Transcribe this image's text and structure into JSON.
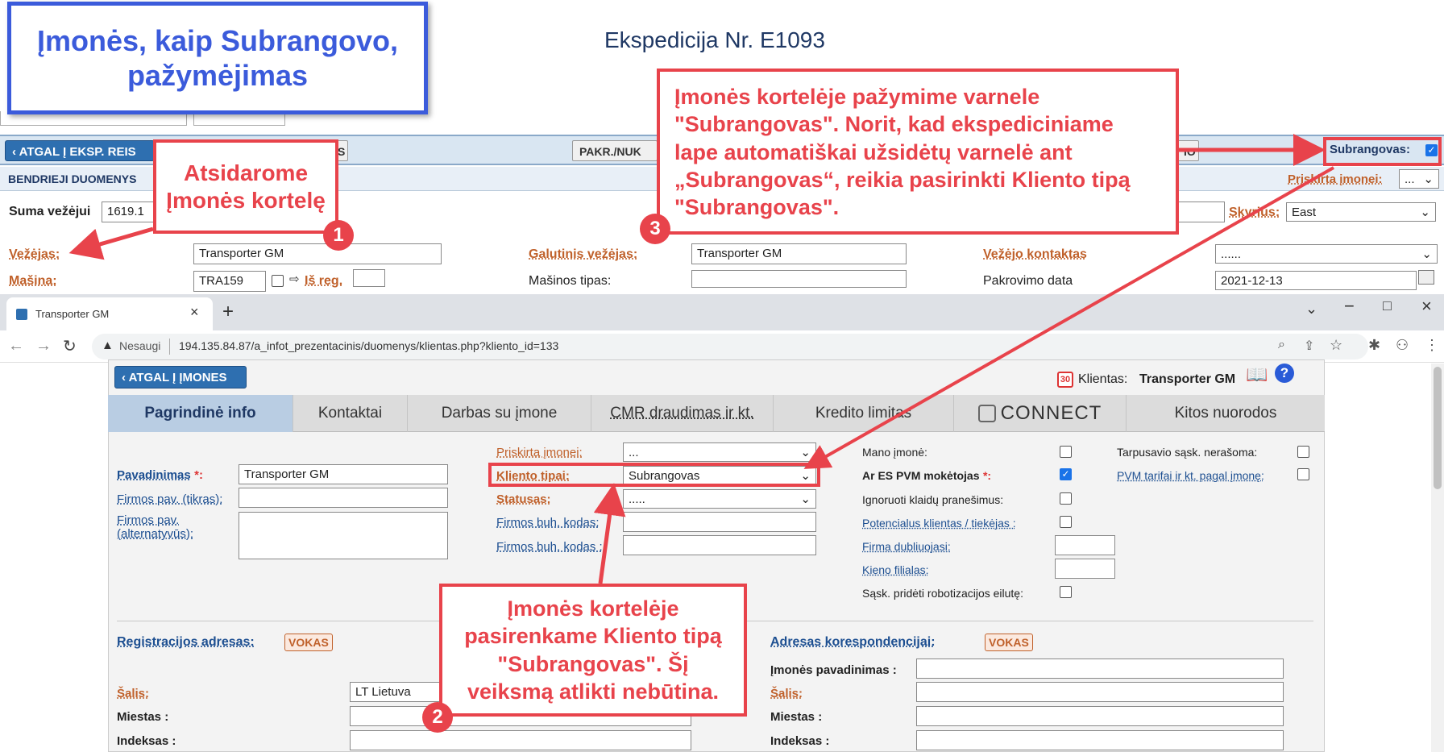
{
  "annotation_title": "Įmonės, kaip Subrangovo, pažymėjimas",
  "bg_app": {
    "expedition_title": "Ekspedicija Nr. E1093",
    "back_button": "ATGAL Į EKSP. REIS",
    "pakr_button": "PAKR./NUK",
    "partial_button": "S",
    "partial_button2": "IO",
    "subrangovas_label": "Subrangovas:",
    "section_label": "BENDRIEJI DUOMENYS",
    "priskirta_label": "Priskirta įmonei:",
    "priskirta_value": "...",
    "suma_label": "Suma vežėjui",
    "suma_value": "1619.1",
    "skyrius_label": "Skyrius:",
    "skyrius_value": "East",
    "vezejas_label": "Vežėjas:",
    "vezejas_value": "Transporter GM",
    "galutinis_label": "Galutinis vežėjas:",
    "galutinis_value": "Transporter GM",
    "vezejo_kontaktas_label": "Vežėjo kontaktas",
    "vezejo_kontaktas_value": "......",
    "masina_label": "Mašina:",
    "masina_value": "TRA159",
    "is_reg_label": "Iš reg.",
    "masinos_tipas_label": "Mašinos tipas:",
    "pakrovimo_label": "Pakrovimo data",
    "pakrovimo_value": "2021-12-13"
  },
  "browser": {
    "tab_title": "Transporter GM",
    "new_tab": "+",
    "not_secure": "Nesaugi",
    "url": "194.135.84.87/a_infot_prezentacinis/duomenys/klientas.php?kliento_id=133"
  },
  "client_page": {
    "back_button": "ATGAL Į ĮMONES",
    "badge_count": "30",
    "klientas_label": "Klientas:",
    "klientas_name": "Transporter GM",
    "tabs": [
      "Pagrindinė info",
      "Kontaktai",
      "Darbas su įmone",
      "CMR draudimas ir kt.",
      "Kredito limitas",
      "CONNECT",
      "Kitos nuorodos"
    ],
    "pavadinimas_label": "Pavadinimas",
    "required_star": "*:",
    "pavadinimas_value": "Transporter GM",
    "firmos_pav_tikras_label": "Firmos pav. (tikras):",
    "firmos_pav_alt_label": "Firmos pav. (alternatyvūs):",
    "priskirta_label": "Priskirta įmonei:",
    "priskirta_value": "...",
    "kliento_tipai_label": "Kliento tipai:",
    "kliento_tipai_value": "Subrangovas",
    "statusas_label": "Statusas:",
    "statusas_value": ".....",
    "firmos_buh_kodas_label": "Firmos buh. kodas:",
    "firmos_buh_kodas2_label": "Firmos buh. kodas :",
    "mano_imone_label": "Mano įmonė:",
    "es_pvm_label": "Ar ES PVM mokėtojas",
    "es_pvm_star": "*:",
    "ignoruoti_label": "Ignoruoti klaidų pranešimus:",
    "potencialus_label": "Potencialus klientas / tiekėjas :",
    "firma_dubl_label": "Firma dubliuojasi:",
    "kieno_filialas_label": "Kieno filialas:",
    "saskaitos_robot_label": "Sąsk. pridėti robotizacijos eilutę:",
    "tarpusavio_label": "Tarpusavio sąsk. nerašoma:",
    "pvm_tarifai_label": "PVM tarifai ir kt. pagal įmonę:",
    "reg_adresas_label": "Registracijos adresas:",
    "vokas_label": "VOKAS",
    "adresas_kor_label": "Adresas korespondencijai:",
    "imones_pav_label": "Įmonės pavadinimas :",
    "salis_label": "Šalis:",
    "salis_value": "LT Lietuva",
    "miestas_label": "Miestas :",
    "indeksas_label": "Indeksas :"
  },
  "annotations": {
    "a1": "Atsidarome Įmonės kortelę",
    "a1_num": "1",
    "a2": "Įmonės kortelėje pasirenkame Kliento tipą \"Subrangovas\". Šį veiksmą atlikti nebūtina.",
    "a2_num": "2",
    "a3": "Įmonės kortelėje pažymime varnele \"Subrangovas\". Norit, kad ekspediciniame lape automatiškai užsidėtų varnelė ant „Subrangovas“, reikia pasirinkti Kliento tipą \"Subrangovas\".",
    "a3_num": "3"
  },
  "colors": {
    "annotation_red": "#e8434b",
    "title_blue": "#3b5bdb",
    "nav_blue": "#2e6fb0",
    "label_orange": "#c0612b"
  }
}
